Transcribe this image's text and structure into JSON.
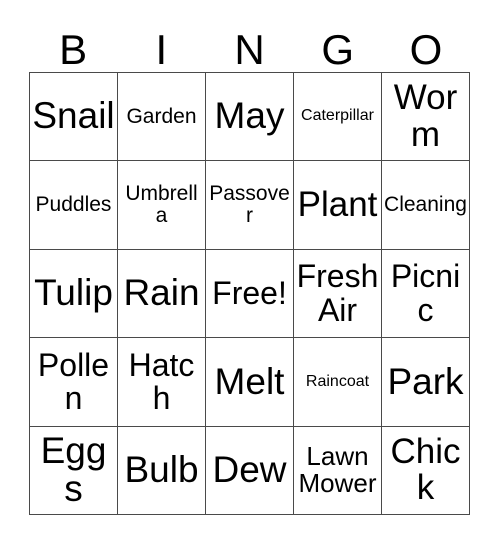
{
  "card": {
    "title": "BINGO Card",
    "header_letters": [
      "B",
      "I",
      "N",
      "G",
      "O"
    ],
    "colors": {
      "background": "#ffffff",
      "text": "#000000",
      "grid_line": "#4a4a4a"
    },
    "grid": {
      "columns": 5,
      "rows": 5,
      "free_space": "Free!",
      "cells": [
        [
          {
            "label": "Snail",
            "size": "xxl"
          },
          {
            "label": "Garden",
            "size": "sm"
          },
          {
            "label": "May",
            "size": "xxl"
          },
          {
            "label": "Caterpillar",
            "size": "xs"
          },
          {
            "label": "Worm",
            "size": "xl"
          }
        ],
        [
          {
            "label": "Puddles",
            "size": "sm"
          },
          {
            "label": "Umbrella",
            "size": "sm"
          },
          {
            "label": "Passover",
            "size": "sm"
          },
          {
            "label": "Plant",
            "size": "xl"
          },
          {
            "label": "Cleaning",
            "size": "sm"
          }
        ],
        [
          {
            "label": "Tulip",
            "size": "xxl"
          },
          {
            "label": "Rain",
            "size": "xxl"
          },
          {
            "label": "Free!",
            "size": "lg"
          },
          {
            "label": "Fresh Air",
            "size": "lg"
          },
          {
            "label": "Picnic",
            "size": "lg"
          }
        ],
        [
          {
            "label": "Pollen",
            "size": "lg"
          },
          {
            "label": "Hatch",
            "size": "lg"
          },
          {
            "label": "Melt",
            "size": "xxl"
          },
          {
            "label": "Raincoat",
            "size": "xs"
          },
          {
            "label": "Park",
            "size": "xxl"
          }
        ],
        [
          {
            "label": "Eggs",
            "size": "xxl"
          },
          {
            "label": "Bulb",
            "size": "xxl"
          },
          {
            "label": "Dew",
            "size": "xxl"
          },
          {
            "label": "Lawn Mower",
            "size": "md"
          },
          {
            "label": "Chick",
            "size": "xl"
          }
        ]
      ]
    }
  }
}
